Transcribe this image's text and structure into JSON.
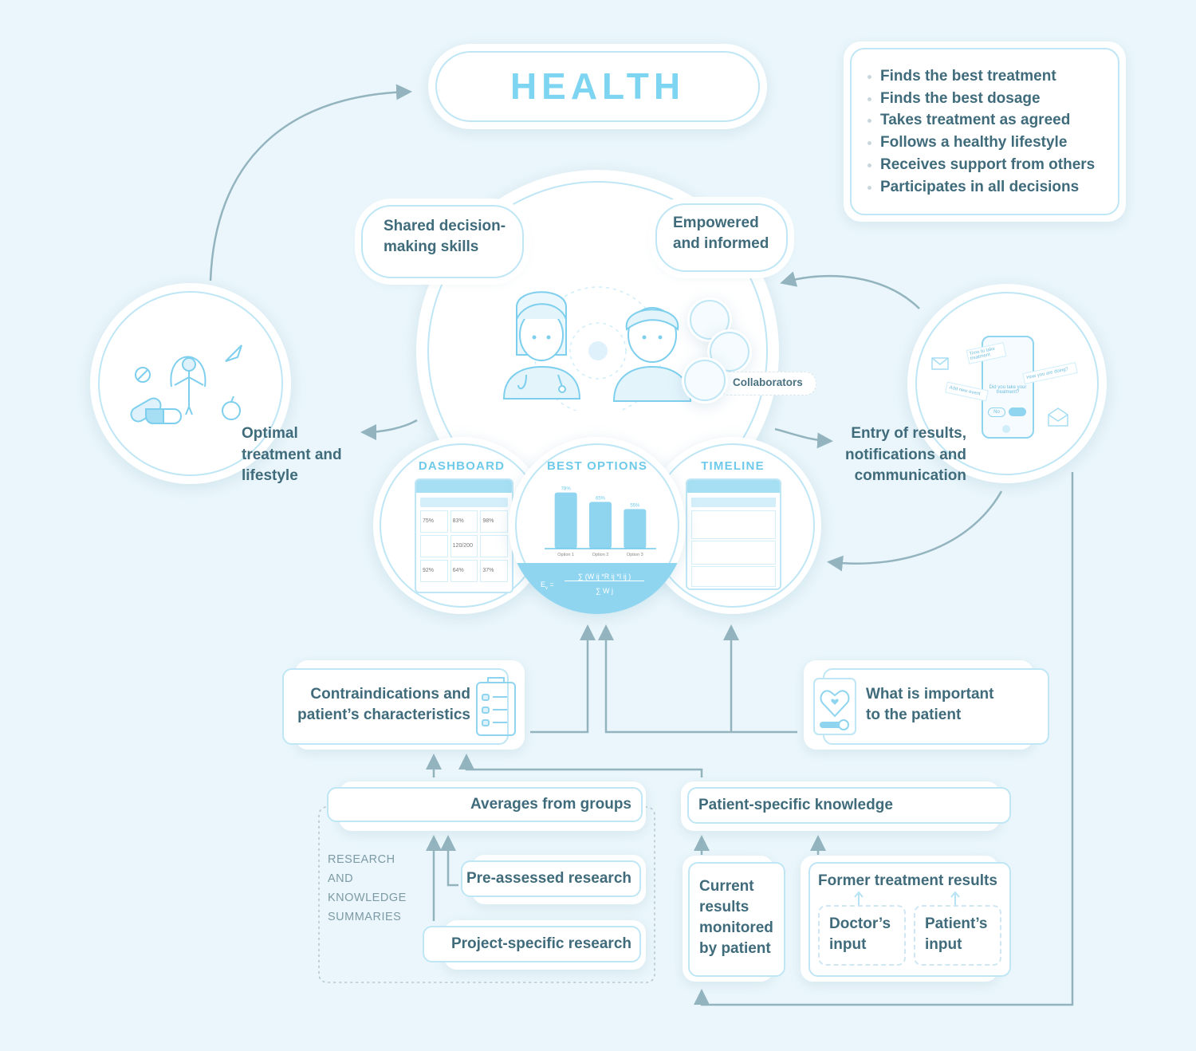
{
  "title": "HEALTH",
  "goals": [
    "Finds the best treatment",
    "Finds the best dosage",
    "Takes treatment as agreed",
    "Follows a healthy lifestyle",
    "Receives support from others",
    "Participates in all decisions"
  ],
  "bubbles": {
    "shared": "Shared decision-\nmaking skills",
    "empowered": "Empowered\nand informed"
  },
  "collaborators_label": "Collaborators",
  "left_circle": {
    "label_lines": [
      "Optimal",
      "treatment and",
      "lifestyle"
    ]
  },
  "right_circle": {
    "label_lines": [
      "Entry of results,",
      "notifications and",
      "communication"
    ],
    "phone": {
      "notice1": "Time to take treatment",
      "notice2": "How you are doing?",
      "notice3": "Add new event",
      "question": "Did you take your treatment?",
      "no_button": "No"
    }
  },
  "sections": {
    "dashboard": {
      "title": "DASHBOARD",
      "tiles": [
        "75%",
        "83%",
        "98%",
        "",
        "120/200",
        "",
        "92%",
        "64%",
        "37%"
      ]
    },
    "best_options": {
      "title": "BEST OPTIONS",
      "formula_lhs": "E",
      "formula_lhs_sub": "v",
      "formula_num": "∑ (W ij *R ij *I ij )",
      "formula_den": "∑ W j"
    },
    "timeline": {
      "title": "TIMELINE"
    }
  },
  "chart_data": {
    "type": "bar",
    "title": "BEST OPTIONS",
    "categories": [
      "Option 1",
      "Option 2",
      "Option 3"
    ],
    "values": [
      78,
      65,
      55
    ],
    "value_labels": [
      "78%",
      "65%",
      "55%"
    ],
    "xlabel": "",
    "ylabel": "",
    "ylim": [
      0,
      100
    ]
  },
  "boxes": {
    "contraindications": "Contraindications and\npatient’s characteristics",
    "important": "What is important\nto the patient",
    "averages": "Averages from groups",
    "pre_assessed": "Pre-assessed research",
    "project_specific": "Project-specific research",
    "research_group_label": [
      "RESEARCH",
      "AND",
      "KNOWLEDGE",
      "SUMMARIES"
    ],
    "patient_knowledge": "Patient-specific knowledge",
    "current_results": [
      "Current",
      "results",
      "monitored",
      "by patient"
    ],
    "former_results": "Former treatment results",
    "doctor_input": [
      "Doctor’s",
      "input"
    ],
    "patient_input": [
      "Patient’s",
      "input"
    ]
  },
  "colors": {
    "background": "#eaf6fb",
    "accent": "#6fcaea",
    "text": "#3f6b7b",
    "line": "#93b4bf",
    "border": "#bfe6f5"
  }
}
